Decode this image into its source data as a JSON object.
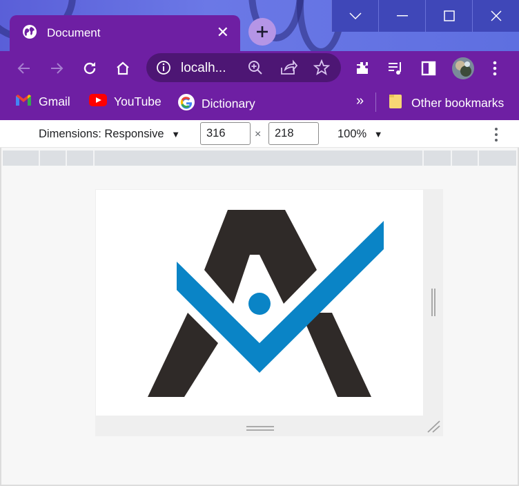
{
  "window": {
    "tab_title": "Document",
    "tab_close_glyph": "✕",
    "new_tab_glyph": "+",
    "controls": [
      "chevron-down-icon",
      "minimize-icon",
      "maximize-icon",
      "close-icon"
    ]
  },
  "toolbar": {
    "url": "localh...",
    "icons": [
      "back-arrow-icon",
      "forward-arrow-icon",
      "reload-icon",
      "home-icon",
      "site-info-icon",
      "zoom-icon",
      "share-icon",
      "star-icon",
      "extensions-icon",
      "media-control-icon",
      "side-panel-icon",
      "profile-avatar",
      "more-menu-icon"
    ]
  },
  "bookmarks": {
    "items": [
      {
        "label": "Gmail",
        "icon": "gmail-icon"
      },
      {
        "label": "YouTube",
        "icon": "youtube-icon"
      },
      {
        "label": "Dictionary",
        "icon": "google-icon"
      }
    ],
    "overflow_glyph": "»",
    "other_label": "Other bookmarks"
  },
  "device_toolbar": {
    "dimensions_label": "Dimensions: Responsive",
    "width_value": "316",
    "times_glyph": "×",
    "height_value": "218",
    "zoom_label": "100%",
    "dropdown_glyph": "▼"
  },
  "colors": {
    "tab_purple": "#6e1fa3",
    "omnibox_purple": "#4d1674",
    "logo_dark": "#2f2a28",
    "logo_blue": "#0a84c6"
  }
}
